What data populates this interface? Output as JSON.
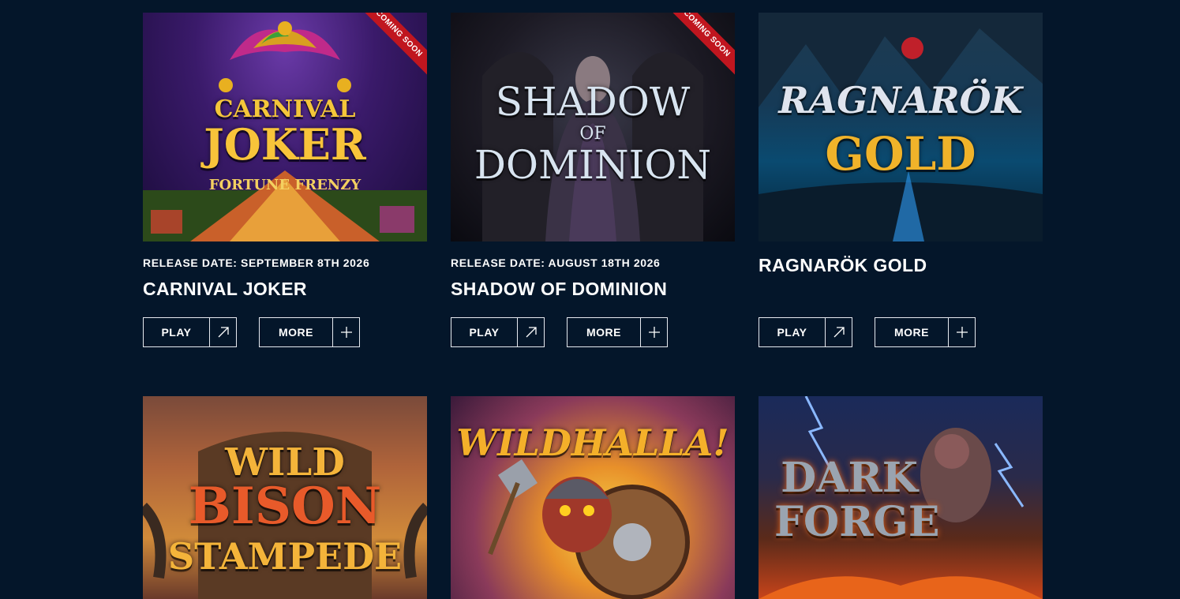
{
  "coming_soon_label": "COMING SOON",
  "play_label": "PLAY",
  "more_label": "MORE",
  "games": [
    {
      "title": "CARNIVAL JOKER",
      "release": "RELEASE DATE: SEPTEMBER 8TH 2026",
      "coming_soon": true,
      "art_lines": [
        "CARNIVAL",
        "JOKER",
        "FORTUNE FRENZY"
      ]
    },
    {
      "title": "SHADOW OF DOMINION",
      "release": "RELEASE DATE: AUGUST 18TH 2026",
      "coming_soon": true,
      "art_lines": [
        "SHADOW",
        "OF",
        "DOMINION"
      ]
    },
    {
      "title": "RAGNARÖK GOLD",
      "release": "",
      "coming_soon": false,
      "art_lines": [
        "RAGNARÖK",
        "GOLD"
      ]
    },
    {
      "art_lines": [
        "WILD",
        "BISON",
        "STAMPEDE"
      ]
    },
    {
      "art_lines": [
        "WILDHALLA!"
      ]
    },
    {
      "art_lines": [
        "DARK",
        "FORGE"
      ]
    }
  ],
  "colors": {
    "background": "#04162a",
    "ribbon": "#c0161f",
    "button_border": "#e6eaf0",
    "text": "#ffffff"
  },
  "icons": {
    "play": "arrow-up-right-icon",
    "more": "plus-icon"
  }
}
